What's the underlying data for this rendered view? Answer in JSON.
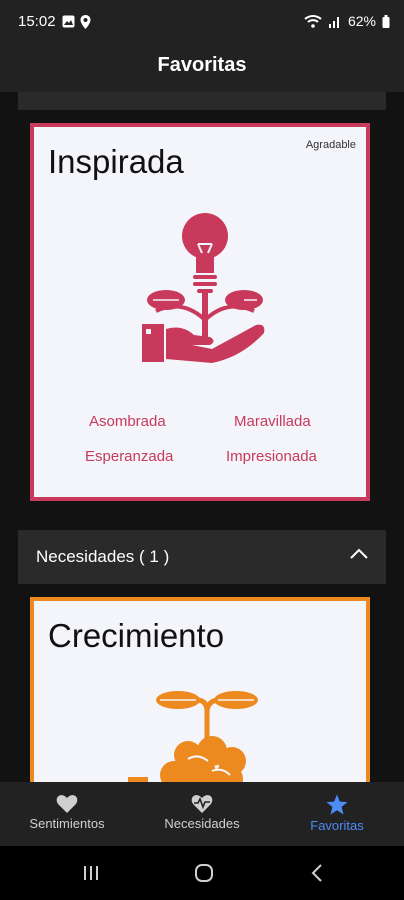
{
  "status": {
    "time": "15:02",
    "battery": "62%"
  },
  "appbar": {
    "title": "Favoritas"
  },
  "cards": [
    {
      "title": "Inspirada",
      "tag": "Agradable",
      "color": "#c8395c",
      "icon": "lightbulb-hand-sprout-icon",
      "emotions": [
        "Asombrada",
        "Maravillada",
        "Esperanzada",
        "Impresionada"
      ]
    },
    {
      "title": "Crecimiento",
      "color": "#ed8a1f",
      "icon": "brain-sprout-icon"
    }
  ],
  "section": {
    "label": "Necesidades ( 1 )"
  },
  "nav": {
    "items": [
      {
        "label": "Sentimientos",
        "icon": "heart-icon"
      },
      {
        "label": "Necesidades",
        "icon": "heart-pulse-icon"
      },
      {
        "label": "Favoritas",
        "icon": "star-icon",
        "active": true
      }
    ],
    "active_color": "#4d8cf6"
  }
}
